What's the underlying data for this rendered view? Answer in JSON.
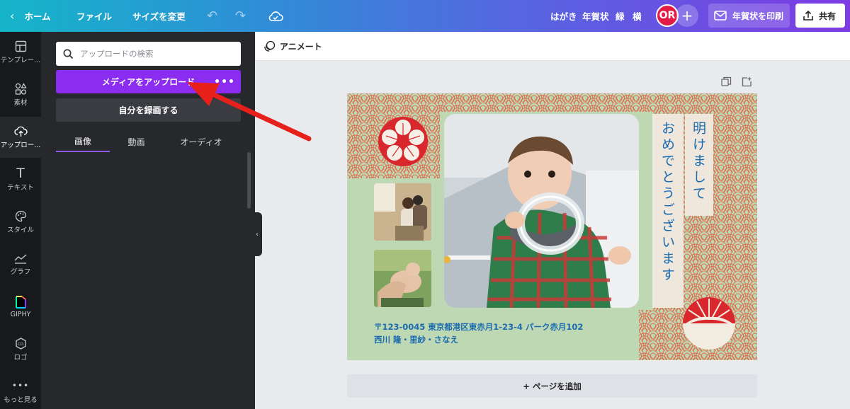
{
  "topbar": {
    "home": "ホーム",
    "file": "ファイル",
    "resize": "サイズを変更",
    "format_tags": [
      "はがき",
      "年賀状",
      "緑",
      "横"
    ],
    "avatar_initials": "OR",
    "print_label": "年賀状を印刷",
    "share_label": "共有"
  },
  "rail": {
    "items": [
      {
        "label": "テンプレー...",
        "icon": "template-icon"
      },
      {
        "label": "素材",
        "icon": "elements-icon"
      },
      {
        "label": "アップロー...",
        "icon": "upload-icon"
      },
      {
        "label": "テキスト",
        "icon": "text-icon"
      },
      {
        "label": "スタイル",
        "icon": "palette-icon"
      },
      {
        "label": "グラフ",
        "icon": "chart-icon"
      },
      {
        "label": "GIPHY",
        "icon": "giphy-icon"
      },
      {
        "label": "ロゴ",
        "icon": "logo-icon"
      },
      {
        "label": "もっと見る",
        "icon": "more-icon"
      }
    ]
  },
  "panel": {
    "search_placeholder": "アップロードの検索",
    "upload_label": "メディアをアップロード",
    "upload_more": "•••",
    "record_label": "自分を録画する",
    "tabs": [
      "画像",
      "動画",
      "オーディオ"
    ]
  },
  "editor": {
    "animate_label": "アニメート",
    "add_page_label": "+ ページを追加"
  },
  "card": {
    "greeting_right": "明けまして",
    "greeting_left": "おめでとうございます",
    "address_line": "〒123-0045 東京都港区東赤月1-23-4 パーク赤月102",
    "names_line": "西川 隆・里紗・さなえ"
  },
  "colors": {
    "accent_purple": "#8b2df0",
    "card_green": "#bfd8b4",
    "text_blue": "#1b6bb0",
    "arrow_red": "#e8201c"
  }
}
